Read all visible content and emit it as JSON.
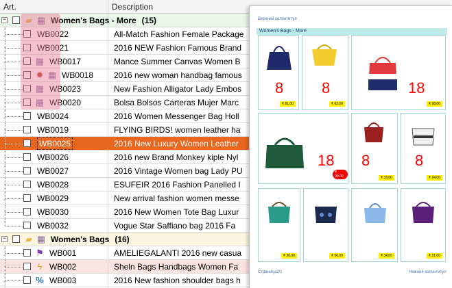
{
  "header": {
    "col_art": "Art.",
    "col_description": "Description"
  },
  "groups": [
    {
      "title": "Women's Bags - More",
      "count": "(15)"
    },
    {
      "title": "Women's Bags",
      "count": "(16)"
    }
  ],
  "rows": [
    {
      "code": "WB0022",
      "desc": "All-Match Fashion Female Package"
    },
    {
      "code": "WB0021",
      "desc": "2016 NEW Fashion Famous Brand"
    },
    {
      "code": "WB0017",
      "desc": "Mance Summer Canvas Women B"
    },
    {
      "code": "WB0018",
      "desc": "2016 new woman handbag famous"
    },
    {
      "code": "WB0023",
      "desc": "New Fashion Alligator Lady Embos"
    },
    {
      "code": "WB0020",
      "desc": "Bolsa Bolsos Carteras Mujer Marc"
    },
    {
      "code": "WB0024",
      "desc": "2016 Women Messenger Bag Holl"
    },
    {
      "code": "WB0019",
      "desc": "FLYING BIRDS! women leather ha"
    },
    {
      "code": "WB0025",
      "desc": "2016 New Luxury Women Leather"
    },
    {
      "code": "WB0026",
      "desc": "2016 new Brand Monkey kiple Nyl"
    },
    {
      "code": "WB0027",
      "desc": "2016 Vintage Women bag Lady PU"
    },
    {
      "code": "WB0028",
      "desc": "ESUFEIR 2016 Fashion Panelled I"
    },
    {
      "code": "WB0029",
      "desc": "New arrival fashion women messe"
    },
    {
      "code": "WB0030",
      "desc": "2016 New Women Tote Bag Luxur"
    },
    {
      "code": "WB0032",
      "desc": "Vogue Star Saffiano bag 2016 Fa"
    },
    {
      "code": "WB001",
      "desc": "AMELIEGALANTI 2016 new casua"
    },
    {
      "code": "WB002",
      "desc": "Sheln Bags Handbags Women Fa"
    },
    {
      "code": "WB003",
      "desc": "2016 New fashion shoulder bags h"
    }
  ],
  "preview": {
    "header_text": "Верхний колонтитул",
    "title": "Women's Bags - More",
    "footer_left": "Страница2/1",
    "footer_right": "Нижний колонтитул",
    "cards": [
      {
        "qty": "8",
        "price": "₹ 61.00"
      },
      {
        "qty": "8",
        "price": "₹ 62.00"
      },
      {
        "qty": "18",
        "price": "₹ 98.00"
      },
      {
        "qty": "18",
        "price": "₹ 00.00"
      },
      {
        "qty": "8",
        "price": "₹ 33.00"
      },
      {
        "qty": "8",
        "price": "₹ 24.00"
      },
      {
        "qty": "",
        "price": "₹ 36.00"
      },
      {
        "qty": "",
        "price": "₹ 56.00"
      },
      {
        "qty": "",
        "price": "₹ 34.00"
      },
      {
        "qty": "",
        "price": "₹ 21.00"
      }
    ]
  },
  "colors": {
    "selected": "#e8661e",
    "group": "#eaf6ea",
    "group2": "#fbf6e0",
    "pink_row": "#fbe3e3",
    "qty_red": "#ff0000"
  }
}
